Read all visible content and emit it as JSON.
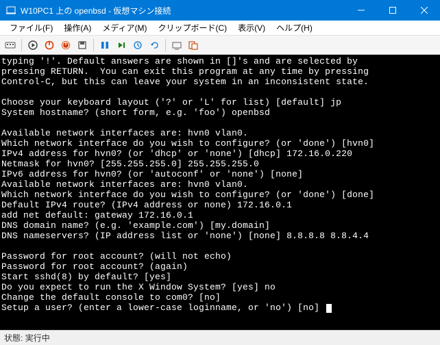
{
  "window": {
    "title": "W10PC1 上の openbsd - 仮想マシン接続"
  },
  "menu": {
    "file": "ファイル(F)",
    "action": "操作(A)",
    "media": "メディア(M)",
    "clipboard": "クリップボード(C)",
    "view": "表示(V)",
    "help": "ヘルプ(H)"
  },
  "terminal": {
    "line0": "typing '!'. Default answers are shown in []'s and are selected by",
    "line1": "pressing RETURN.  You can exit this program at any time by pressing",
    "line2": "Control-C, but this can leave your system in an inconsistent state.",
    "line3": "",
    "line4": "Choose your keyboard layout ('?' or 'L' for list) [default] jp",
    "line5": "System hostname? (short form, e.g. 'foo') openbsd",
    "line6": "",
    "line7": "Available network interfaces are: hvn0 vlan0.",
    "line8": "Which network interface do you wish to configure? (or 'done') [hvn0]",
    "line9": "IPv4 address for hvn0? (or 'dhcp' or 'none') [dhcp] 172.16.0.220",
    "line10": "Netmask for hvn0? [255.255.255.0] 255.255.255.0",
    "line11": "IPv6 address for hvn0? (or 'autoconf' or 'none') [none]",
    "line12": "Available network interfaces are: hvn0 vlan0.",
    "line13": "Which network interface do you wish to configure? (or 'done') [done]",
    "line14": "Default IPv4 route? (IPv4 address or none) 172.16.0.1",
    "line15": "add net default: gateway 172.16.0.1",
    "line16": "DNS domain name? (e.g. 'example.com') [my.domain]",
    "line17": "DNS nameservers? (IP address list or 'none') [none] 8.8.8.8 8.8.4.4",
    "line18": "",
    "line19": "Password for root account? (will not echo)",
    "line20": "Password for root account? (again)",
    "line21": "Start sshd(8) by default? [yes]",
    "line22": "Do you expect to run the X Window System? [yes] no",
    "line23": "Change the default console to com0? [no]",
    "line24": "Setup a user? (enter a lower-case loginname, or 'no') [no] "
  },
  "status": {
    "label": "状態:",
    "value": "実行中"
  }
}
